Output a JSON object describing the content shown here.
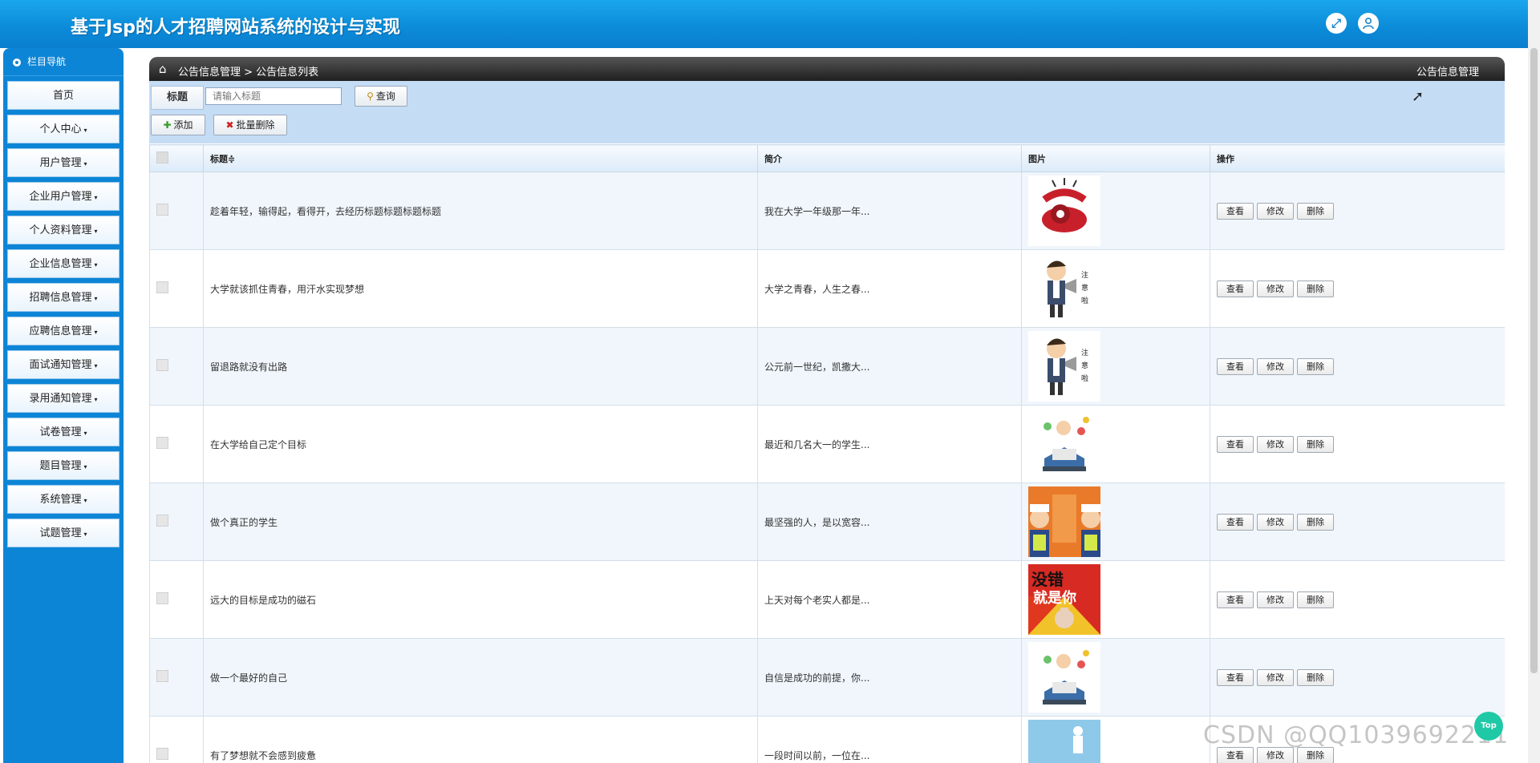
{
  "header": {
    "title": "基于Jsp的人才招聘网站系统的设计与实现",
    "icons": [
      "fullscreen-icon",
      "user-icon"
    ]
  },
  "sidebar": {
    "heading": "栏目导航",
    "items": [
      {
        "label": "首页",
        "has_caret": false
      },
      {
        "label": "个人中心",
        "has_caret": true
      },
      {
        "label": "用户管理",
        "has_caret": true
      },
      {
        "label": "企业用户管理",
        "has_caret": true
      },
      {
        "label": "个人资料管理",
        "has_caret": true
      },
      {
        "label": "企业信息管理",
        "has_caret": true
      },
      {
        "label": "招聘信息管理",
        "has_caret": true
      },
      {
        "label": "应聘信息管理",
        "has_caret": true
      },
      {
        "label": "面试通知管理",
        "has_caret": true
      },
      {
        "label": "录用通知管理",
        "has_caret": true
      },
      {
        "label": "试卷管理",
        "has_caret": true
      },
      {
        "label": "题目管理",
        "has_caret": true
      },
      {
        "label": "系统管理",
        "has_caret": true
      },
      {
        "label": "试题管理",
        "has_caret": true
      }
    ]
  },
  "breadcrumb": {
    "path": "公告信息管理 > 公告信息列表",
    "right_title": "公告信息管理"
  },
  "search": {
    "label": "标题",
    "placeholder": "请输入标题",
    "button": "查询"
  },
  "actions": {
    "add": "添加",
    "batch_delete": "批量删除"
  },
  "table": {
    "headers": {
      "title": "标题",
      "sort_mark": "≑",
      "summary": "简介",
      "image": "图片",
      "operation": "操作"
    },
    "row_actions": {
      "view": "查看",
      "edit": "修改",
      "delete": "删除"
    },
    "rows": [
      {
        "title": "趁着年轻，输得起，看得开，去经历标题标题标题标题",
        "summary": "我在大学一年级那一年...",
        "image": "red-telephone"
      },
      {
        "title": "大学就该抓住青春，用汗水实现梦想",
        "summary": "大学之青春，人生之春...",
        "image": "man-megaphone"
      },
      {
        "title": "留退路就没有出路",
        "summary": "公元前一世纪，凯撒大...",
        "image": "man-megaphone"
      },
      {
        "title": "在大学给自己定个目标",
        "summary": "最近和几名大一的学生...",
        "image": "reader-balloons"
      },
      {
        "title": "做个真正的学生",
        "summary": "最坚强的人，是以宽容...",
        "image": "orange-building-police"
      },
      {
        "title": "远大的目标是成功的磁石",
        "summary": "上天对每个老实人都是...",
        "image": "poster-pointing"
      },
      {
        "title": "做一个最好的自己",
        "summary": "自信是成功的前提，你...",
        "image": "reader-balloons"
      },
      {
        "title": "有了梦想就不会感到疲惫",
        "summary": "一段时间以前，一位在...",
        "image": "blue-sky-figure"
      }
    ]
  },
  "overlay": {
    "watermark": "CSDN @QQ1039692211",
    "fab_label": "Top"
  },
  "colors": {
    "header_blue": "#0b8ad8",
    "sidebar_blue": "#0d85d6",
    "toolbar_bg": "#c5dcf5",
    "fab_green": "#1fc9a6"
  }
}
